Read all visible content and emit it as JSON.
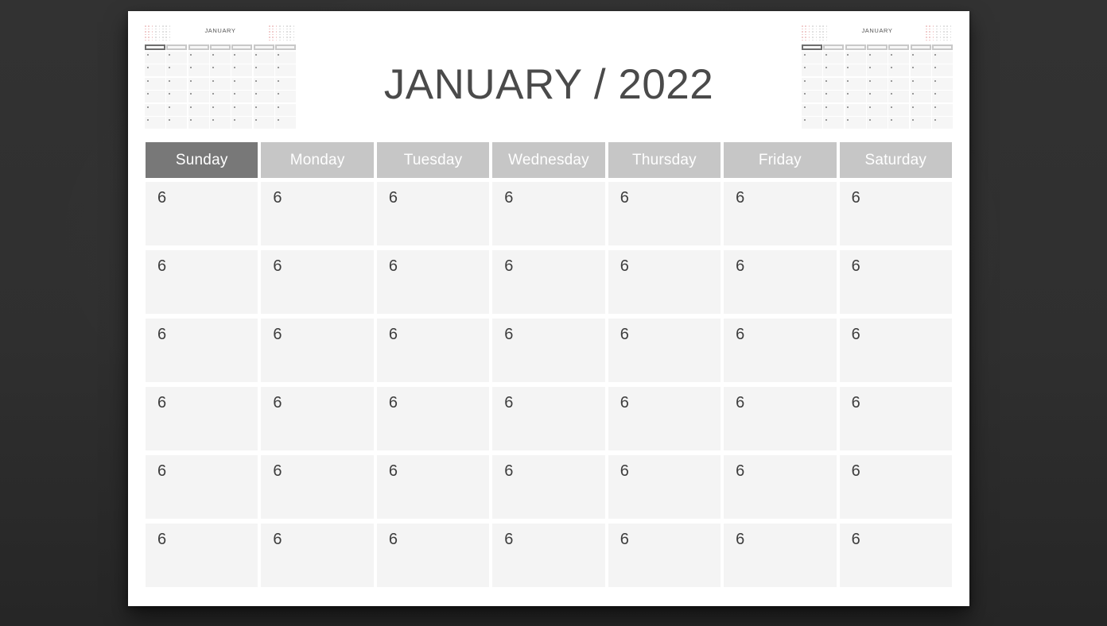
{
  "background_color": "#333333",
  "page": {
    "background_color": "#ffffff",
    "title": "JANUARY / 2022"
  },
  "thumbnails": {
    "left": {
      "title": "JANUARY"
    },
    "right": {
      "title": "JANUARY"
    }
  },
  "calendar": {
    "month": "JANUARY",
    "year": "2022",
    "day_headers": [
      {
        "label": "Sunday",
        "highlighted": true,
        "color": "#787878"
      },
      {
        "label": "Monday",
        "highlighted": false,
        "color": "#c6c6c6"
      },
      {
        "label": "Tuesday",
        "highlighted": false,
        "color": "#c6c6c6"
      },
      {
        "label": "Wednesday",
        "highlighted": false,
        "color": "#c6c6c6"
      },
      {
        "label": "Thursday",
        "highlighted": false,
        "color": "#c6c6c6"
      },
      {
        "label": "Friday",
        "highlighted": false,
        "color": "#c6c6c6"
      },
      {
        "label": "Saturday",
        "highlighted": false,
        "color": "#c6c6c6"
      }
    ],
    "weeks": [
      [
        "6",
        "6",
        "6",
        "6",
        "6",
        "6",
        "6"
      ],
      [
        "6",
        "6",
        "6",
        "6",
        "6",
        "6",
        "6"
      ],
      [
        "6",
        "6",
        "6",
        "6",
        "6",
        "6",
        "6"
      ],
      [
        "6",
        "6",
        "6",
        "6",
        "6",
        "6",
        "6"
      ],
      [
        "6",
        "6",
        "6",
        "6",
        "6",
        "6",
        "6"
      ],
      [
        "6",
        "6",
        "6",
        "6",
        "6",
        "6",
        "6"
      ]
    ],
    "cell_color": "#f4f4f4",
    "date_text_color": "#3d3d3d"
  }
}
